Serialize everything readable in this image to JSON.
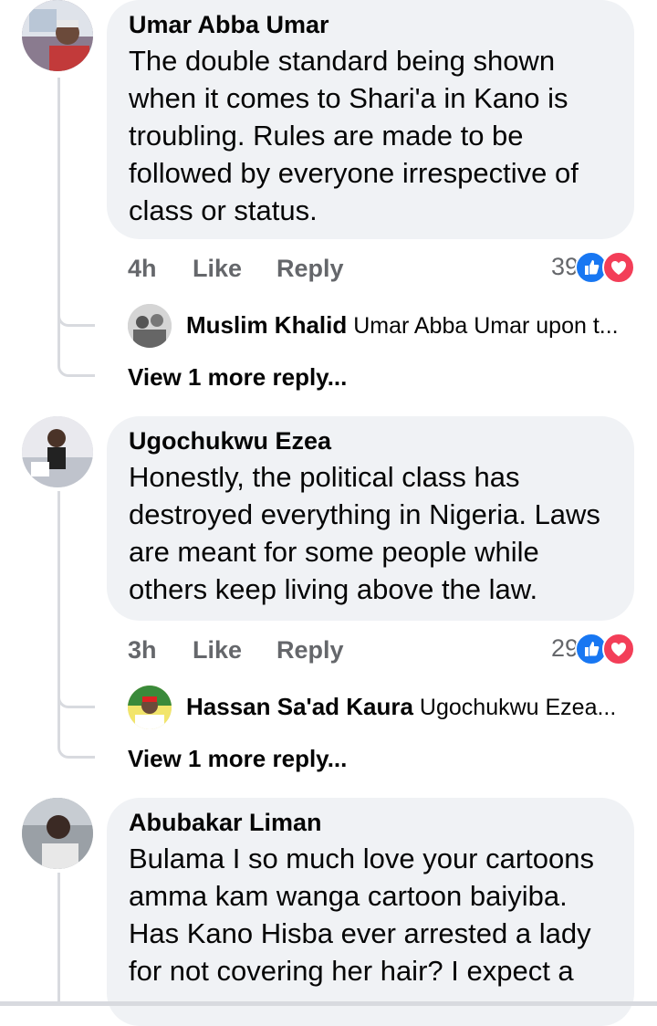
{
  "comments": [
    {
      "author": "Umar Abba Umar",
      "lines": [
        "The double standard being shown",
        "when it comes to Shari'a in Kano is",
        "troubling. Rules are made to be",
        "followed by everyone irrespective of",
        "class or status."
      ],
      "time": "4h",
      "like_label": "Like",
      "reply_label": "Reply",
      "reaction_count": "39",
      "reply_preview": {
        "author": "Muslim Khalid",
        "snippet": "Umar Abba Umar upon t..."
      },
      "more_replies": "View 1 more reply..."
    },
    {
      "author": "Ugochukwu Ezea",
      "lines": [
        "Honestly, the political class has",
        "destroyed everything in Nigeria. Laws",
        "are meant for some people while",
        "others keep living above the law."
      ],
      "time": "3h",
      "like_label": "Like",
      "reply_label": "Reply",
      "reaction_count": "29",
      "reply_preview": {
        "author": "Hassan Sa'ad Kaura",
        "snippet": "Ugochukwu Ezea..."
      },
      "more_replies": "View 1 more reply..."
    },
    {
      "author": "Abubakar Liman",
      "lines": [
        "Bulama I so much love your cartoons",
        "amma kam wanga cartoon baiyiba.",
        "Has Kano Hisba ever arrested a lady",
        "for not covering her hair? I expect a"
      ]
    }
  ],
  "icons": {
    "like": "thumbs-up-icon",
    "love": "heart-icon"
  },
  "colors": {
    "like": "#1877f2",
    "love": "#f33e58",
    "bubble": "#f0f2f5",
    "meta": "#65676b"
  }
}
